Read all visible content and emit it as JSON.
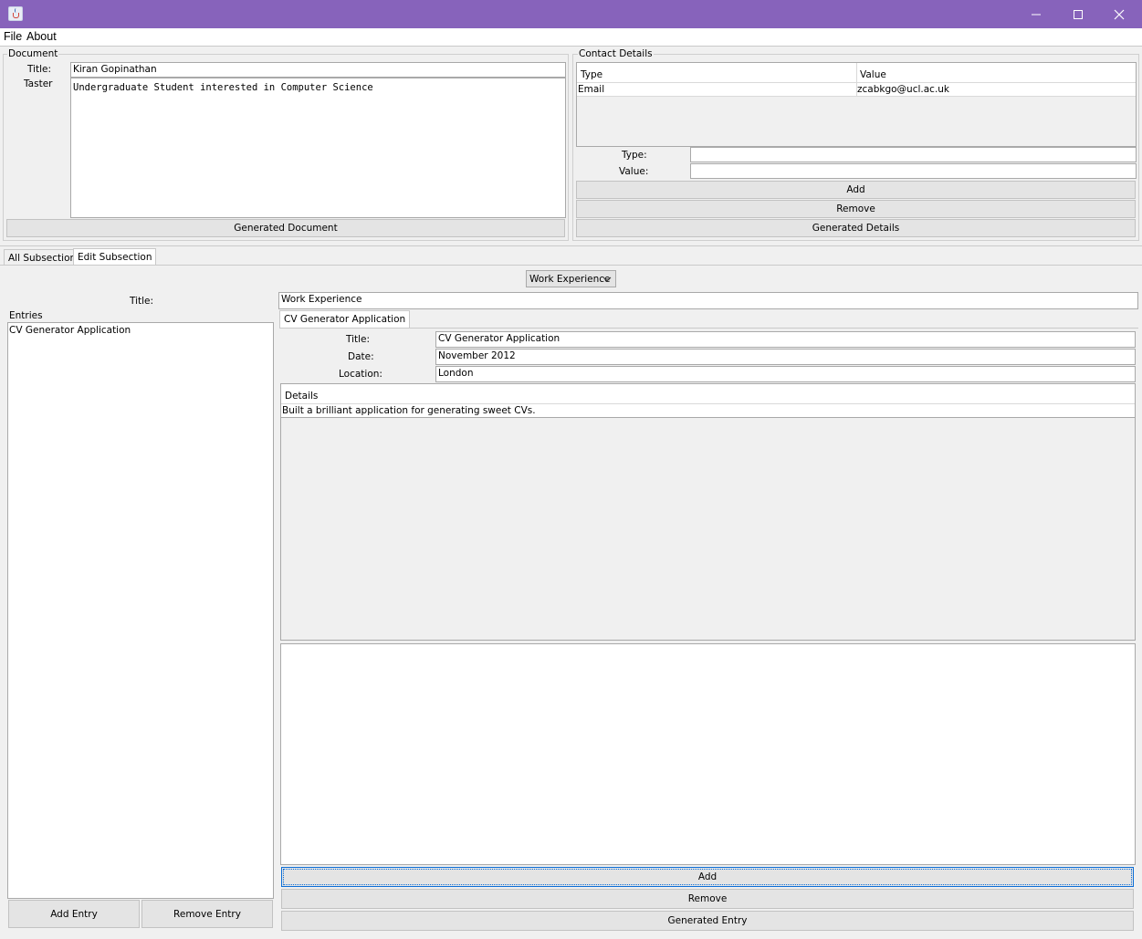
{
  "window": {
    "title": ""
  },
  "menu": {
    "items": [
      "File",
      "About"
    ]
  },
  "document_panel": {
    "legend": "Document",
    "title_label": "Title:",
    "title_value": "Kiran Gopinathan",
    "taster_label": "Taster",
    "taster_value": "Undergraduate Student interested in Computer Science",
    "generate_button": "Generated Document"
  },
  "contact_panel": {
    "legend": "Contact Details",
    "columns": [
      "Type",
      "Value"
    ],
    "rows": [
      {
        "type": "Email",
        "value": "zcabkgo@ucl.ac.uk"
      }
    ],
    "type_label": "Type:",
    "value_label": "Value:",
    "type_value": "",
    "value_value": "",
    "add_button": "Add",
    "remove_button": "Remove",
    "generate_button": "Generated Details"
  },
  "tabs": [
    "All Subsections",
    "Edit Subsection"
  ],
  "subsection": {
    "type_selected": "Work Experience",
    "title_label": "Title:",
    "title_value": "Work Experience",
    "entries_legend": "Entries",
    "entries": [
      "CV Generator Application"
    ],
    "add_entry_button": "Add Entry",
    "remove_entry_button": "Remove Entry"
  },
  "entry": {
    "tab_label": "CV Generator Application",
    "title_label": "Title:",
    "title_value": "CV Generator Application",
    "date_label": "Date:",
    "date_value": "November 2012",
    "location_label": "Location:",
    "location_value": "London",
    "details_header": "Details",
    "details": [
      "Built a brilliant application for generating sweet CVs."
    ],
    "detail_input_value": "",
    "add_button": "Add",
    "remove_button": "Remove",
    "generate_button": "Generated Entry"
  },
  "colors": {
    "titlebar": "#8763bb",
    "focus": "#0b6dd6"
  },
  "icons": [
    "java-app-icon",
    "minimize-icon",
    "maximize-icon",
    "close-icon",
    "chevron-down-icon"
  ]
}
